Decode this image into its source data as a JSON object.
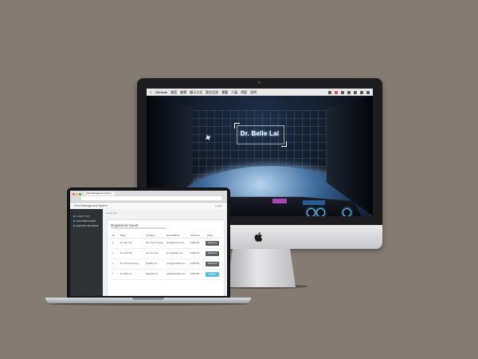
{
  "desktop": {
    "menubar_app": "Chrome",
    "menubar_items": [
      "檔案",
      "編輯",
      "顯示方式",
      "歷史記錄",
      "書籤",
      "人員",
      "視窗",
      "說明"
    ],
    "target_name": "Dr. Belle Lai"
  },
  "laptop": {
    "tab_title": "Event Management System",
    "brand": "Event Management System",
    "nav_right": "Logout",
    "sidebar": [
      {
        "label": "GUEST LIST",
        "active": true
      },
      {
        "label": "ADD NEW GUEST",
        "active": false
      },
      {
        "label": "EXPORT RECORDS",
        "active": false
      }
    ],
    "breadcrumb": "Guest List",
    "panel_title": "Registered Guest",
    "columns": [
      "ID",
      "Name",
      "Company",
      "Email Address",
      "Phone No.",
      "Action"
    ],
    "rows": [
      {
        "id": "1",
        "name": "Mr. Alan Yam",
        "company": "Alan Yam Company",
        "email": "alan@alanyam.com",
        "phone": "23456789",
        "action": "Registered",
        "registered": true
      },
      {
        "id": "2",
        "name": "Mr. Kevin Ma",
        "company": "Let It Go Corp",
        "email": "kevin@letitgo.com",
        "phone": "23456789",
        "action": "Registered",
        "registered": true
      },
      {
        "id": "3",
        "name": "Mr. Roosevelt Yeung",
        "company": "ZetaBits Ltd",
        "email": "yeung@zetabits.com",
        "phone": "23456789",
        "action": "Registered",
        "registered": true
      },
      {
        "id": "4",
        "name": "Mr. Willis Lai",
        "company": "Happylab Ltd",
        "email": "willis@happylab.com",
        "phone": "34567890",
        "action": "Register",
        "registered": false
      }
    ]
  },
  "colors": {
    "background": "#847b72",
    "accent": "#5bc0de",
    "registered": "#5a5e63"
  }
}
